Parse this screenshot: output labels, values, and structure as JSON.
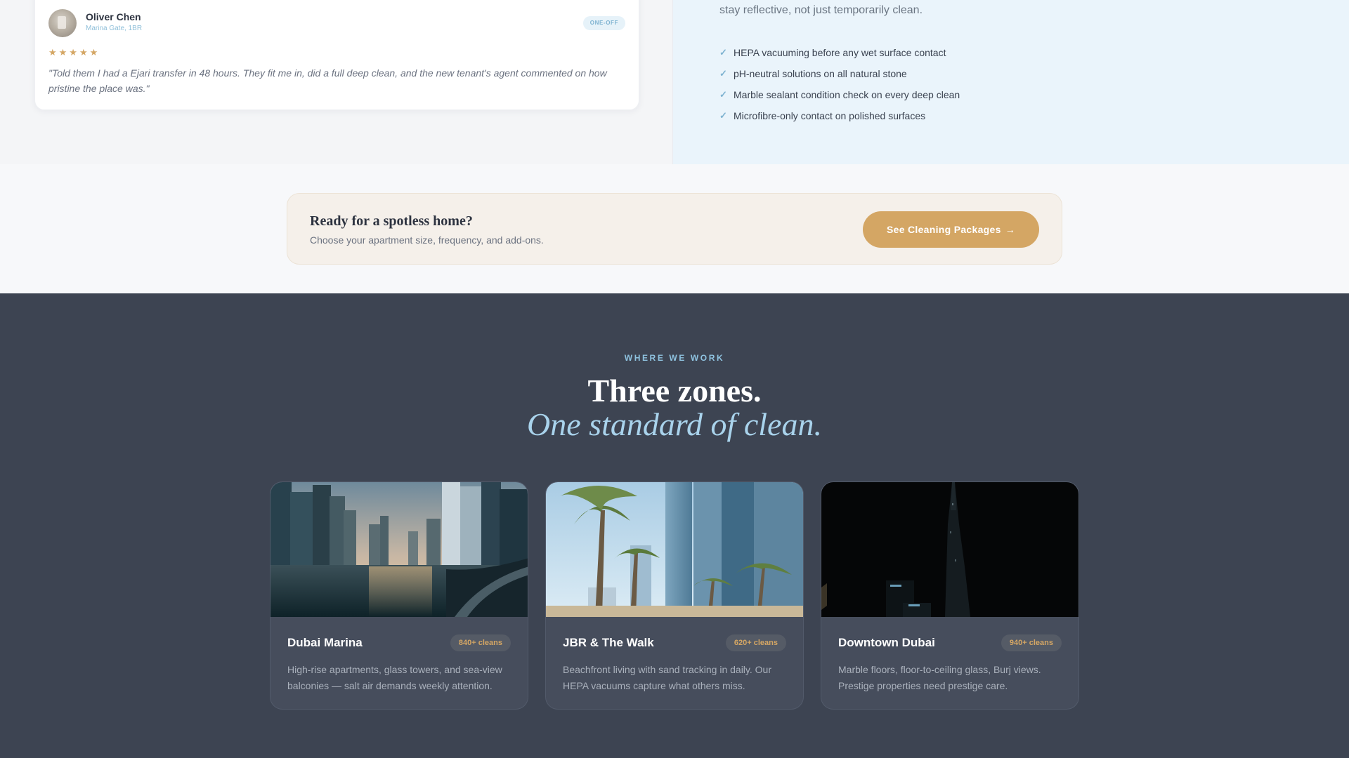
{
  "testimonial": {
    "avatar_icon": "avatar-photo",
    "name": "Oliver Chen",
    "location": "Marina Gate, 1BR",
    "badge": "ONE-OFF",
    "rating": 5,
    "stars": "★★★★★",
    "quote": "\"Told them I had a Ejari transfer in 48 hours. They fit me in, did a full deep clean, and the new tenant's agent commented on how pristine the place was.\""
  },
  "features": {
    "intro": "stay reflective, not just temporarily clean.",
    "check_icon": "check-icon",
    "items": [
      "HEPA vacuuming before any wet surface contact",
      "pH-neutral solutions on all natural stone",
      "Marble sealant condition check on every deep clean",
      "Microfibre-only contact on polished surfaces"
    ]
  },
  "cta": {
    "title": "Ready for a spotless home?",
    "subtitle": "Choose your apartment size, frequency, and add-ons.",
    "button_label": "See Cleaning Packages",
    "button_icon": "arrow-right-icon"
  },
  "zones": {
    "eyebrow": "WHERE WE WORK",
    "headline": "Three zones.",
    "headline_italic": "One standard of clean.",
    "cards": [
      {
        "name": "Dubai Marina",
        "count": "840+ cleans",
        "description": "High-rise apartments, glass towers, and sea-view balconies — salt air demands weekly attention.",
        "image": "marina-sunset-photo"
      },
      {
        "name": "JBR & The Walk",
        "count": "620+ cleans",
        "description": "Beachfront living with sand tracking in daily. Our HEPA vacuums capture what others miss.",
        "image": "palm-towers-photo"
      },
      {
        "name": "Downtown Dubai",
        "count": "940+ cleans",
        "description": "Marble floors, floor-to-ceiling glass, Burj views. Prestige properties need prestige care.",
        "image": "burj-night-photo"
      }
    ]
  },
  "colors": {
    "accent_gold": "#d4a664",
    "accent_blue": "#8fc3e0",
    "dark_bg": "#3d4452",
    "card_bg": "#464d5c"
  }
}
